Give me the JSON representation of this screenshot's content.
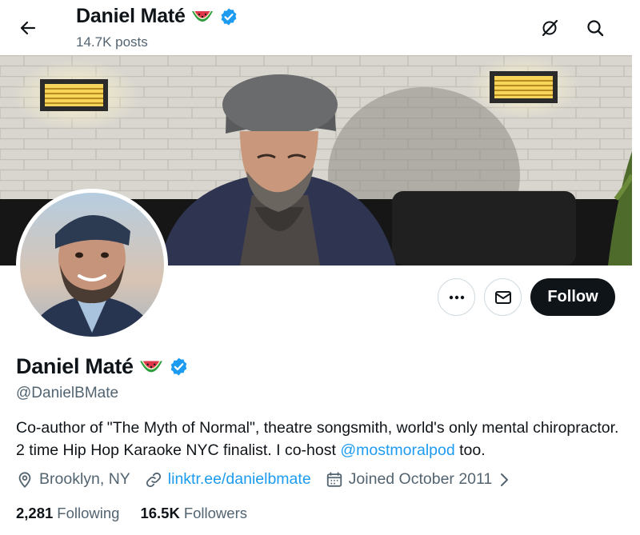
{
  "header": {
    "name": "Daniel Maté",
    "posts": "14.7K posts"
  },
  "profile": {
    "display_name": "Daniel Maté",
    "handle": "@DanielBMate",
    "bio_text": "Co-author of \"The Myth of Normal\", theatre songsmith, world's only mental chiropractor. 2 time Hip Hop Karaoke NYC finalist. I co-host ",
    "bio_mention": "@mostmoralpod",
    "bio_suffix": " too.",
    "location": "Brooklyn, NY",
    "website": "linktr.ee/danielbmate",
    "joined": "Joined October 2011"
  },
  "actions": {
    "follow_label": "Follow"
  },
  "stats": {
    "following_count": "2,281",
    "following_label": "Following",
    "followers_count": "16.5K",
    "followers_label": "Followers"
  },
  "colors": {
    "accent": "#1d9bf0",
    "text": "#0f1419",
    "muted": "#536471",
    "follow_bg": "#0f1419"
  },
  "icons": [
    "back-arrow-icon",
    "grok-icon",
    "search-icon",
    "watermelon-emoji",
    "verified-badge-icon",
    "more-icon",
    "mail-icon",
    "location-icon",
    "link-icon",
    "calendar-icon",
    "chevron-right-icon"
  ]
}
